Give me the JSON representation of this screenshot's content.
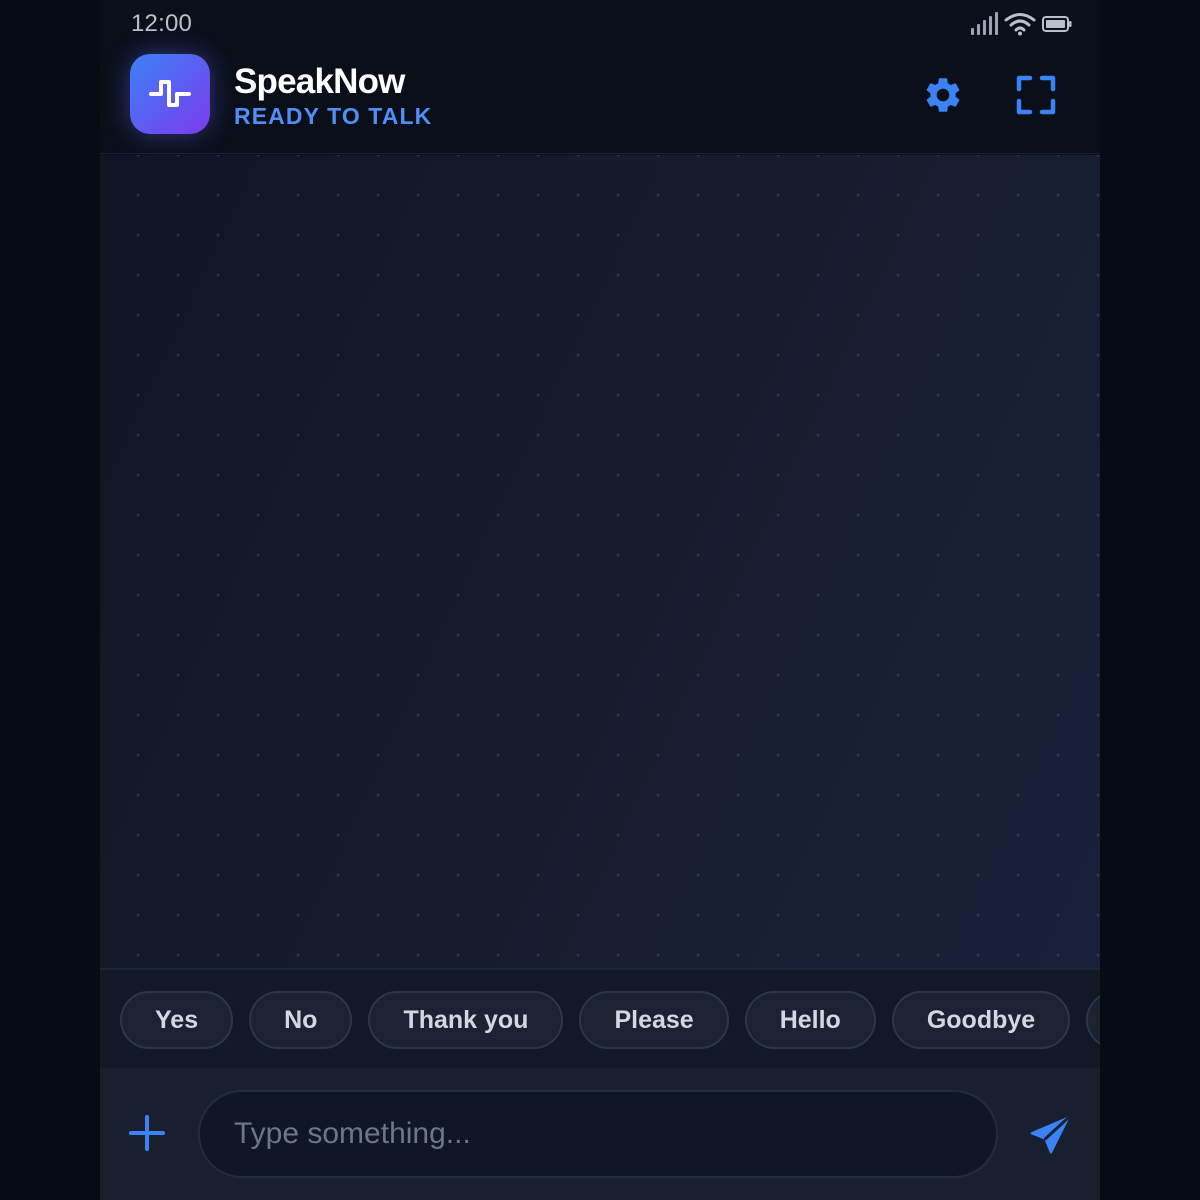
{
  "status_bar": {
    "time": "12:00",
    "icons": [
      "signal-icon",
      "wifi-icon",
      "battery-icon"
    ]
  },
  "header": {
    "app_name": "SpeakNow",
    "status": "READY TO TALK",
    "logo_icon": "waveform-icon",
    "settings_icon": "gear-icon",
    "fullscreen_icon": "fullscreen-icon"
  },
  "quick_replies": [
    {
      "label": "Yes"
    },
    {
      "label": "No"
    },
    {
      "label": "Thank you"
    },
    {
      "label": "Please"
    },
    {
      "label": "Hello"
    },
    {
      "label": "Goodbye"
    },
    {
      "label": ""
    }
  ],
  "composer": {
    "placeholder": "Type something...",
    "value": "",
    "add_icon": "plus-icon",
    "send_icon": "send-icon"
  },
  "colors": {
    "accent": "#3b82f6",
    "accent_purple": "#7c3aed",
    "background": "#0a0f1a",
    "status_text": "#4f8ff7"
  }
}
